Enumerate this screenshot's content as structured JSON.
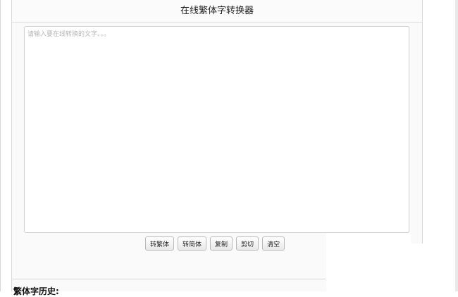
{
  "header": {
    "title": "在线繁体字转换器"
  },
  "editor": {
    "value": "",
    "placeholder": "请输入要在线转换的文字。。。"
  },
  "toolbar": {
    "to_traditional_label": "转繁体",
    "to_simplified_label": "转简体",
    "copy_label": "复制",
    "cut_label": "剪切",
    "clear_label": "清空"
  },
  "history": {
    "label": "繁体字历史:"
  },
  "colors": {
    "panel_bg": "#fafafa",
    "border": "#d9d9d9"
  }
}
